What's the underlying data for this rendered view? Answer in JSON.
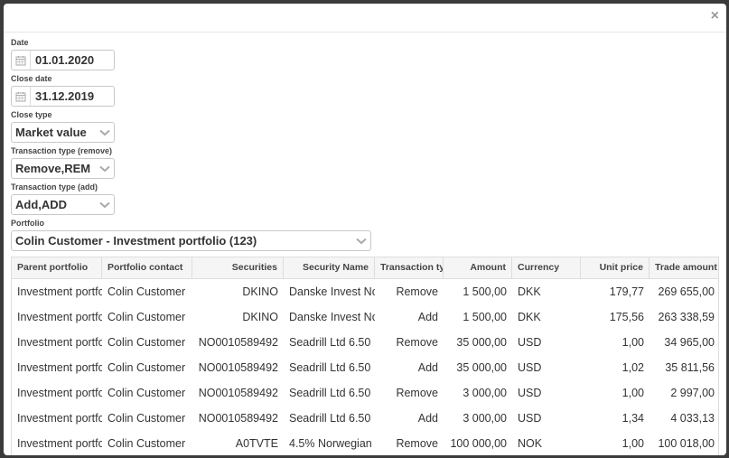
{
  "modal": {
    "close_label": "×"
  },
  "form": {
    "date": {
      "label": "Date",
      "value": "01.01.2020"
    },
    "close_date": {
      "label": "Close date",
      "value": "31.12.2019"
    },
    "close_type": {
      "label": "Close type",
      "value": "Market value"
    },
    "transaction_type_remove": {
      "label": "Transaction type (remove)",
      "value": "Remove,REM"
    },
    "transaction_type_add": {
      "label": "Transaction type (add)",
      "value": "Add,ADD"
    },
    "portfolio": {
      "label": "Portfolio",
      "value": "Colin Customer - Investment portfolio (123)"
    }
  },
  "grid": {
    "columns": [
      "Parent portfolio",
      "Portfolio contact",
      "Securities",
      "Security Name",
      "Transaction type",
      "Amount",
      "Currency",
      "Unit price",
      "Trade amount"
    ],
    "rows": [
      [
        "Investment portfolio",
        "Colin Customer",
        "DKINO",
        "Danske Invest Norge",
        "Remove",
        "1 500,00",
        "DKK",
        "179,77",
        "269 655,00"
      ],
      [
        "Investment portfolio",
        "Colin Customer",
        "DKINO",
        "Danske Invest Norge",
        "Add",
        "1 500,00",
        "DKK",
        "175,56",
        "263 338,59"
      ],
      [
        "Investment portfolio",
        "Colin Customer",
        "NO0010589492",
        "Seadrill Ltd 6.50",
        "Remove",
        "35 000,00",
        "USD",
        "1,00",
        "34 965,00"
      ],
      [
        "Investment portfolio",
        "Colin Customer",
        "NO0010589492",
        "Seadrill Ltd 6.50",
        "Add",
        "35 000,00",
        "USD",
        "1,02",
        "35 811,56"
      ],
      [
        "Investment portfolio",
        "Colin Customer",
        "NO0010589492",
        "Seadrill Ltd 6.50",
        "Remove",
        "3 000,00",
        "USD",
        "1,00",
        "2 997,00"
      ],
      [
        "Investment portfolio",
        "Colin Customer",
        "NO0010589492",
        "Seadrill Ltd 6.50",
        "Add",
        "3 000,00",
        "USD",
        "1,34",
        "4 033,13"
      ],
      [
        "Investment portfolio",
        "Colin Customer",
        "A0TVTE",
        "4.5% Norwegian",
        "Remove",
        "100 000,00",
        "NOK",
        "1,00",
        "100 018,00"
      ]
    ]
  },
  "icons": {
    "calendar": "calendar-icon",
    "chevron": "chevron-down-icon",
    "close": "close-icon"
  }
}
